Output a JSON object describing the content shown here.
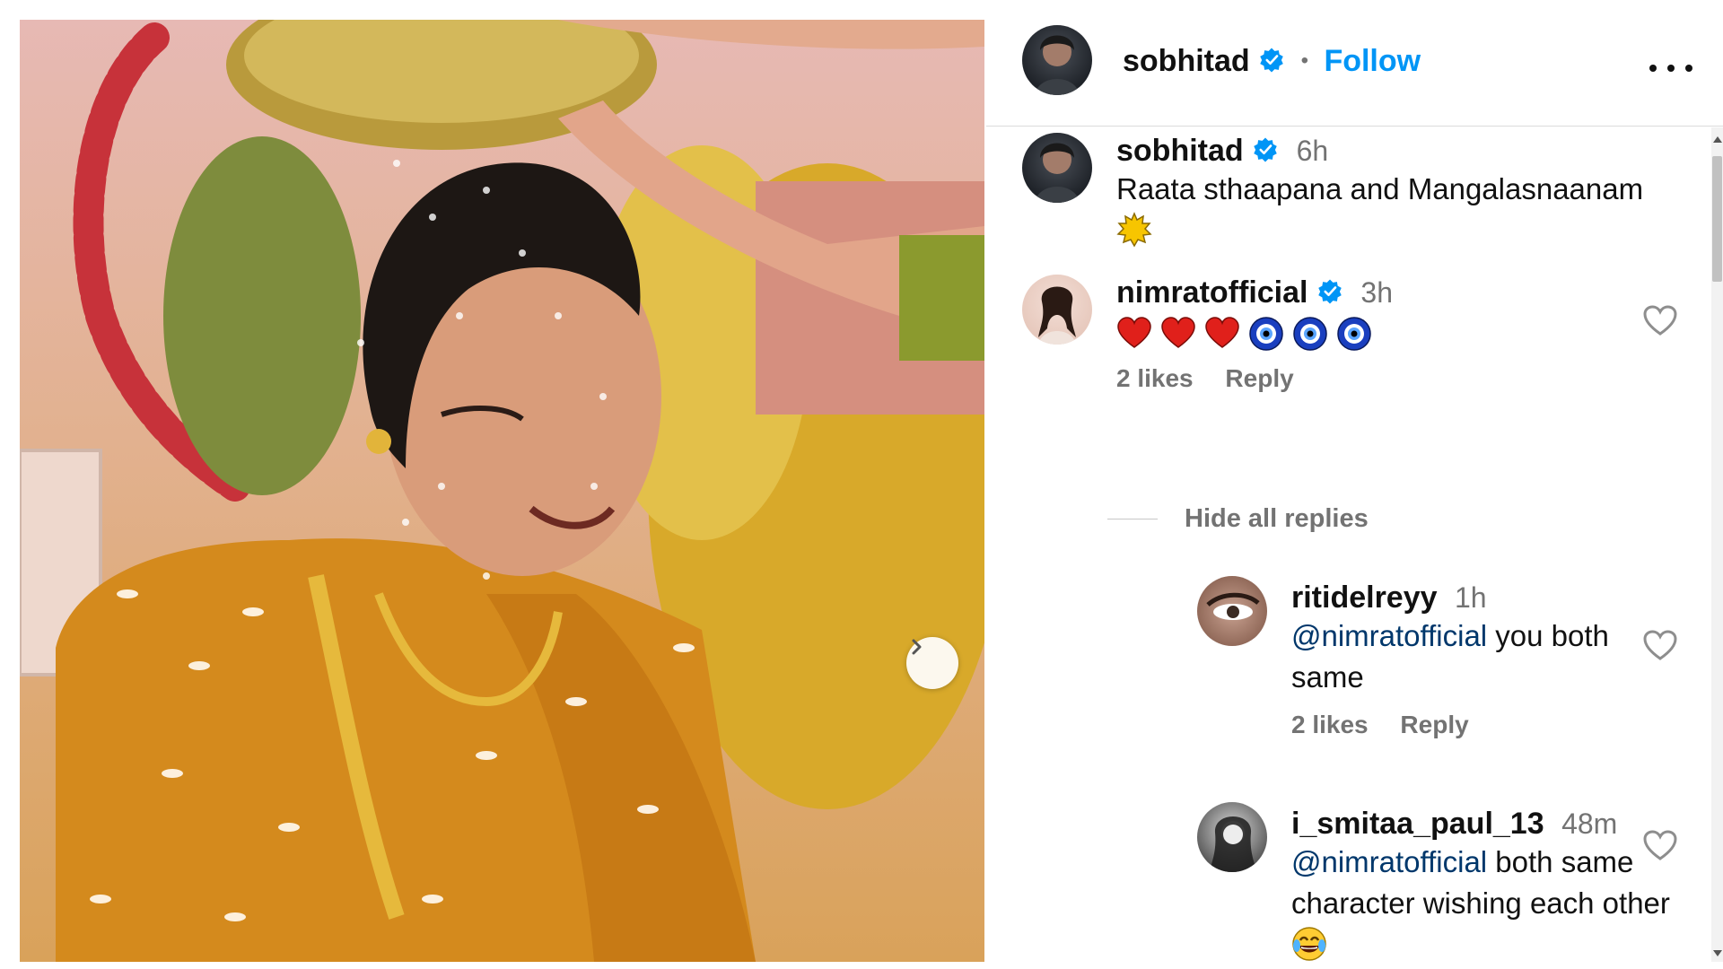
{
  "post": {
    "photo_alt": "",
    "next_icon": "chevron-right-icon"
  },
  "header": {
    "username": "sobhitad",
    "separator": "•",
    "follow_label": "Follow",
    "more_icon": "more-horizontal-icon"
  },
  "caption": {
    "username": "sobhitad",
    "time": "6h",
    "text": "Raata sthaapana and Mangalasnaanam",
    "emoji": "☀"
  },
  "comments": [
    {
      "username": "nimratofficial",
      "verified": true,
      "time": "3h",
      "emojis": [
        "❤",
        "❤",
        "❤",
        "🧿",
        "🧿",
        "🧿"
      ],
      "likes": "2 likes",
      "reply_label": "Reply"
    }
  ],
  "hide_replies_label": "Hide all replies",
  "replies": [
    {
      "username": "ritidelreyy",
      "time": "1h",
      "mention": "@nimratofficial",
      "text": " you both same",
      "likes": "2 likes",
      "reply_label": "Reply"
    },
    {
      "username": "i_smitaa_paul_13",
      "time": "48m",
      "mention": "@nimratofficial",
      "text": " both same character wishing each other",
      "emoji": "😂"
    }
  ],
  "colors": {
    "link_blue": "#0095f6",
    "mention_blue": "#00376b",
    "muted": "#737373",
    "heart_red": "#e0201b"
  }
}
